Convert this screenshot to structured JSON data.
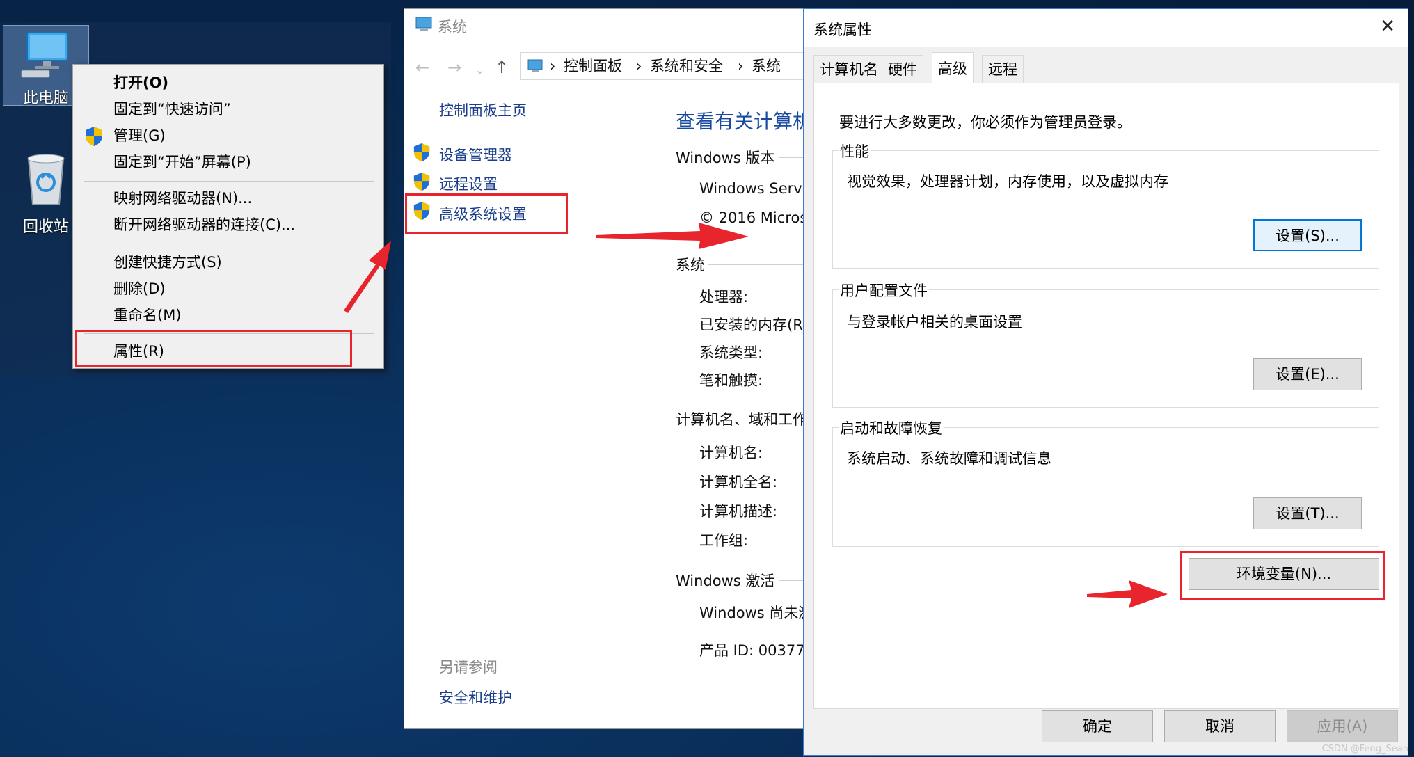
{
  "desktop": {
    "icons": [
      {
        "label": "此电脑",
        "icon": "computer-icon"
      },
      {
        "label": "回收站",
        "icon": "recycle-bin-icon"
      }
    ]
  },
  "context_menu": {
    "items": [
      {
        "label": "打开(O)"
      },
      {
        "label": "固定到“快速访问”"
      },
      {
        "label": "管理(G)"
      },
      {
        "label": "固定到“开始”屏幕(P)"
      },
      {
        "label": "映射网络驱动器(N)..."
      },
      {
        "label": "断开网络驱动器的连接(C)..."
      },
      {
        "label": "创建快捷方式(S)"
      },
      {
        "label": "删除(D)"
      },
      {
        "label": "重命名(M)"
      },
      {
        "label": "属性(R)"
      }
    ]
  },
  "control_panel": {
    "window_title": "系统",
    "breadcrumb": [
      "控制面板",
      "系统和安全",
      "系统"
    ],
    "sidebar": {
      "home": "控制面板主页",
      "links": [
        "设备管理器",
        "远程设置",
        "高级系统设置"
      ],
      "see_also_label": "另请参阅",
      "see_also_link": "安全和维护"
    },
    "main": {
      "heading": "查看有关计算机",
      "windows_edition_label": "Windows 版本",
      "edition_name": "Windows Serve",
      "copyright": "© 2016 Micros",
      "system_label": "系统",
      "system_fields": [
        "处理器:",
        "已安装的内存(R",
        "系统类型:",
        "笔和触摸:"
      ],
      "computer_label": "计算机名、域和工作",
      "computer_fields": [
        "计算机名:",
        "计算机全名:",
        "计算机描述:",
        "工作组:"
      ],
      "activation_label": "Windows 激活",
      "activation_status": "Windows 尚未激",
      "product_id": "产品 ID: 00377-"
    }
  },
  "system_properties": {
    "title": "系统属性",
    "tabs": [
      "计算机名",
      "硬件",
      "高级",
      "远程"
    ],
    "active_tab": "高级",
    "admin_notice": "要进行大多数更改，你必须作为管理员登录。",
    "groups": [
      {
        "title": "性能",
        "desc": "视觉效果，处理器计划，内存使用，以及虚拟内存",
        "button": "设置(S)..."
      },
      {
        "title": "用户配置文件",
        "desc": "与登录帐户相关的桌面设置",
        "button": "设置(E)..."
      },
      {
        "title": "启动和故障恢复",
        "desc": "系统启动、系统故障和调试信息",
        "button": "设置(T)..."
      }
    ],
    "env_button": "环境变量(N)...",
    "ok": "确定",
    "cancel": "取消",
    "apply": "应用(A)"
  },
  "watermark": "CSDN @Feng_Sean",
  "colors": {
    "highlight": "#e8242c",
    "link": "#1a3e8c",
    "focus": "#0078d7"
  }
}
